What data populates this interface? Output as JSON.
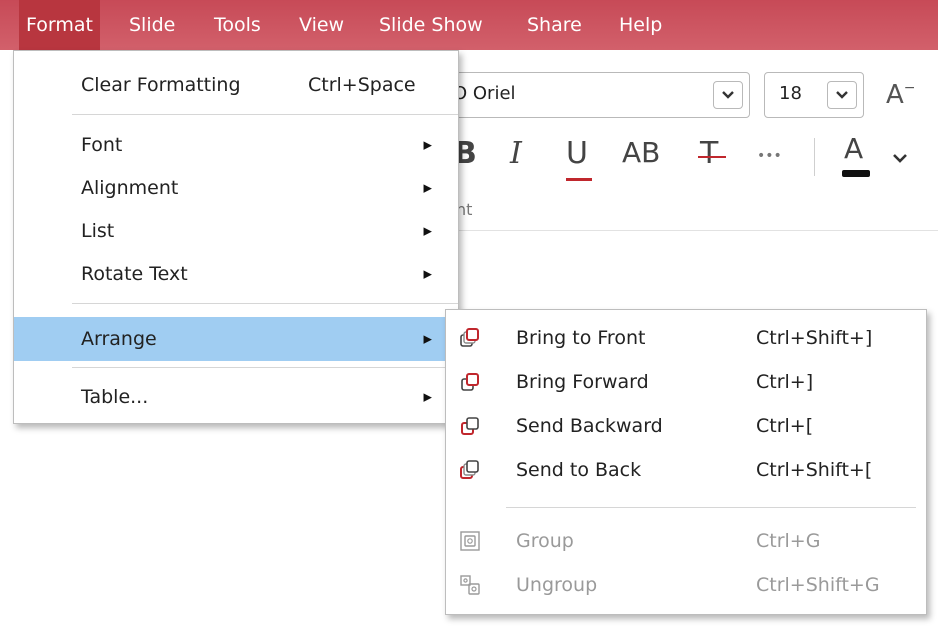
{
  "menubar": {
    "items": [
      "Format",
      "Slide",
      "Tools",
      "View",
      "Slide Show",
      "Share",
      "Help"
    ],
    "active": "Format"
  },
  "ribbon": {
    "font_name": "O Oriel",
    "font_size": "18",
    "grow_font": "A",
    "group_label_fragment": "nt",
    "buttons": {
      "bold": "B",
      "italic": "I",
      "underline": "U",
      "caps": "AB",
      "strike": "T",
      "more": "•••",
      "font_color": "A"
    }
  },
  "format_menu": {
    "items": [
      {
        "label": "Clear Formatting",
        "shortcut": "Ctrl+Space"
      },
      {
        "label": "Font"
      },
      {
        "label": "Alignment"
      },
      {
        "label": "List"
      },
      {
        "label": "Rotate Text"
      },
      {
        "label": "Arrange"
      },
      {
        "label": "Table..."
      }
    ]
  },
  "arrange_menu": {
    "items": [
      {
        "label": "Bring to Front",
        "shortcut": "Ctrl+Shift+]",
        "icon": "bring-to-front-icon"
      },
      {
        "label": "Bring Forward",
        "shortcut": "Ctrl+]",
        "icon": "bring-forward-icon"
      },
      {
        "label": "Send Backward",
        "shortcut": "Ctrl+[",
        "icon": "send-backward-icon"
      },
      {
        "label": "Send to Back",
        "shortcut": "Ctrl+Shift+[",
        "icon": "send-to-back-icon"
      },
      {
        "label": "Group",
        "shortcut": "Ctrl+G",
        "icon": "group-icon",
        "disabled": true
      },
      {
        "label": "Ungroup",
        "shortcut": "Ctrl+Shift+G",
        "icon": "ungroup-icon",
        "disabled": true
      }
    ]
  },
  "colors": {
    "menubar": "#cf5763",
    "menubar_active": "#b8363f",
    "highlight": "#a0cdf2",
    "icon_red": "#c0272d",
    "disabled": "#9a9a9a"
  }
}
